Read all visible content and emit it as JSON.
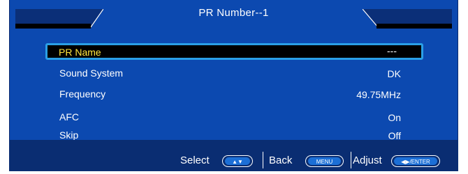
{
  "header": {
    "title": "PR Number--1"
  },
  "menu": {
    "items": [
      {
        "label": "PR Name",
        "value": "---"
      },
      {
        "label": "Sound System",
        "value": "DK"
      },
      {
        "label": "Frequency",
        "value": "49.75MHz"
      },
      {
        "label": "AFC",
        "value": "On"
      },
      {
        "label": "Skip",
        "value": "Off"
      }
    ],
    "selected_index": 0
  },
  "footer": {
    "select_label": "Select",
    "select_key": "▲▼",
    "back_label": "Back",
    "back_key": "MENU",
    "adjust_label": "Adjust",
    "adjust_key": "◀▶/ENTER"
  },
  "colors": {
    "background": "#0c49b0",
    "footer": "#0a2d72",
    "highlight_border": "#2a9fe6",
    "highlight_text": "#ffe640"
  }
}
